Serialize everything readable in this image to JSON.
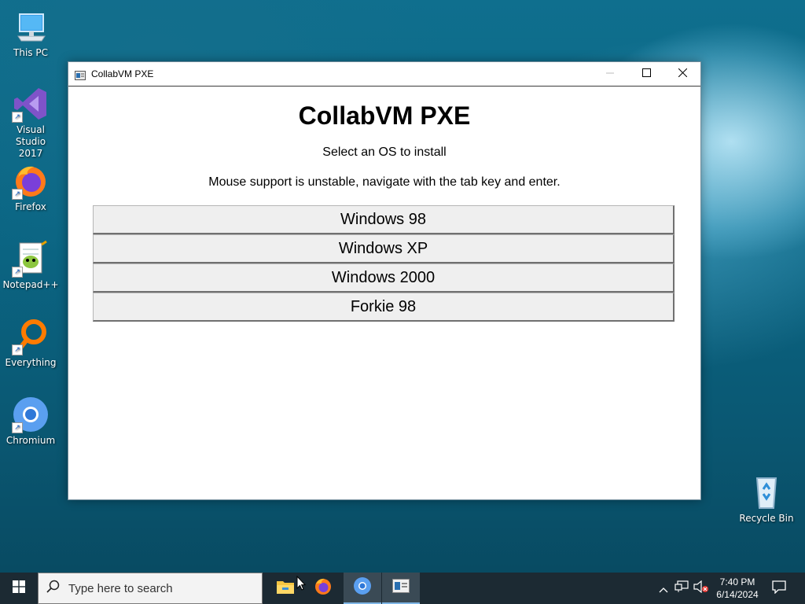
{
  "desktop": {
    "icons": [
      {
        "label": "This PC"
      },
      {
        "label": "Visual Studio\n2017"
      },
      {
        "label": "Firefox"
      },
      {
        "label": "Notepad++"
      },
      {
        "label": "Everything"
      },
      {
        "label": "Chromium"
      },
      {
        "label": "Recycle Bin"
      }
    ]
  },
  "window": {
    "title": "CollabVM PXE",
    "heading": "CollabVM PXE",
    "subtitle": "Select an OS to install",
    "hint": "Mouse support is unstable, navigate with the tab key and enter.",
    "options": [
      {
        "label": "Windows 98"
      },
      {
        "label": "Windows XP"
      },
      {
        "label": "Windows 2000"
      },
      {
        "label": "Forkie 98"
      }
    ]
  },
  "taskbar": {
    "search_placeholder": "Type here to search",
    "time": "7:40 PM",
    "date": "6/14/2024"
  },
  "colors": {
    "taskbar_bg": "#1c2a33",
    "button_bg": "#efefef",
    "accent": "#7fb6e6"
  }
}
